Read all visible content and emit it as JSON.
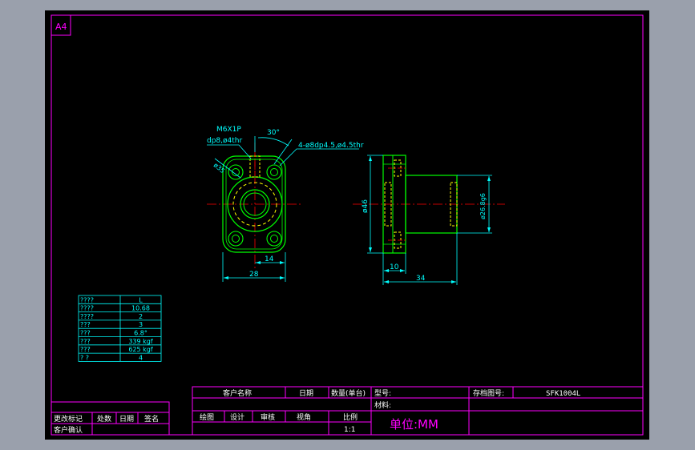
{
  "sheet": {
    "size_tag": "A4"
  },
  "colors": {
    "background": "#000000",
    "frame": "#ff00ff",
    "outline": "#ffffff",
    "dimension": "#00ffff",
    "part": "#00ff00",
    "hidden": "#ffff00",
    "centerline": "#ff0000",
    "chrome": "#9aa0ac"
  },
  "front_view": {
    "thread_callout_1": "M6X1P",
    "thread_callout_2": "dp8,ø4thr",
    "angle_dim": "30°",
    "hole_callout": "4-ø8dp4.5,ø4.5thr",
    "pcd_dim": "ø35",
    "width_dim": "28",
    "half_width_dim": "14"
  },
  "side_view": {
    "flange_dia_dim": "ø46",
    "body_dia_dim": "ø26.8g6",
    "flange_thk_dim": "10",
    "length_dim": "34"
  },
  "spec_table": {
    "rows": [
      {
        "key": "????",
        "value": "L"
      },
      {
        "key": "????",
        "value": "10.68"
      },
      {
        "key": "????",
        "value": "2"
      },
      {
        "key": "???",
        "value": "3"
      },
      {
        "key": "???",
        "value": "6.8°"
      },
      {
        "key": "???",
        "value": "339 kgf"
      },
      {
        "key": "???",
        "value": "625 kgf"
      },
      {
        "key": "?   ?",
        "value": "4"
      }
    ]
  },
  "revision_block": {
    "change_mark": "更改标记",
    "location": "处数",
    "date": "日期",
    "signature": "签名",
    "customer_confirm": "客户确认"
  },
  "title_block": {
    "customer_name": "客户名称",
    "date": "日期",
    "quantity": "数量(单台)",
    "model_no": "型号:",
    "drawing_no_label": "存档图号:",
    "drawing_no": "SFK1004L",
    "material": "材料:",
    "drawn": "绘图",
    "design": "设计",
    "review": "审核",
    "view_angle": "视角",
    "scale": "比例",
    "scale_value": "1:1",
    "unit": "单位:MM"
  }
}
